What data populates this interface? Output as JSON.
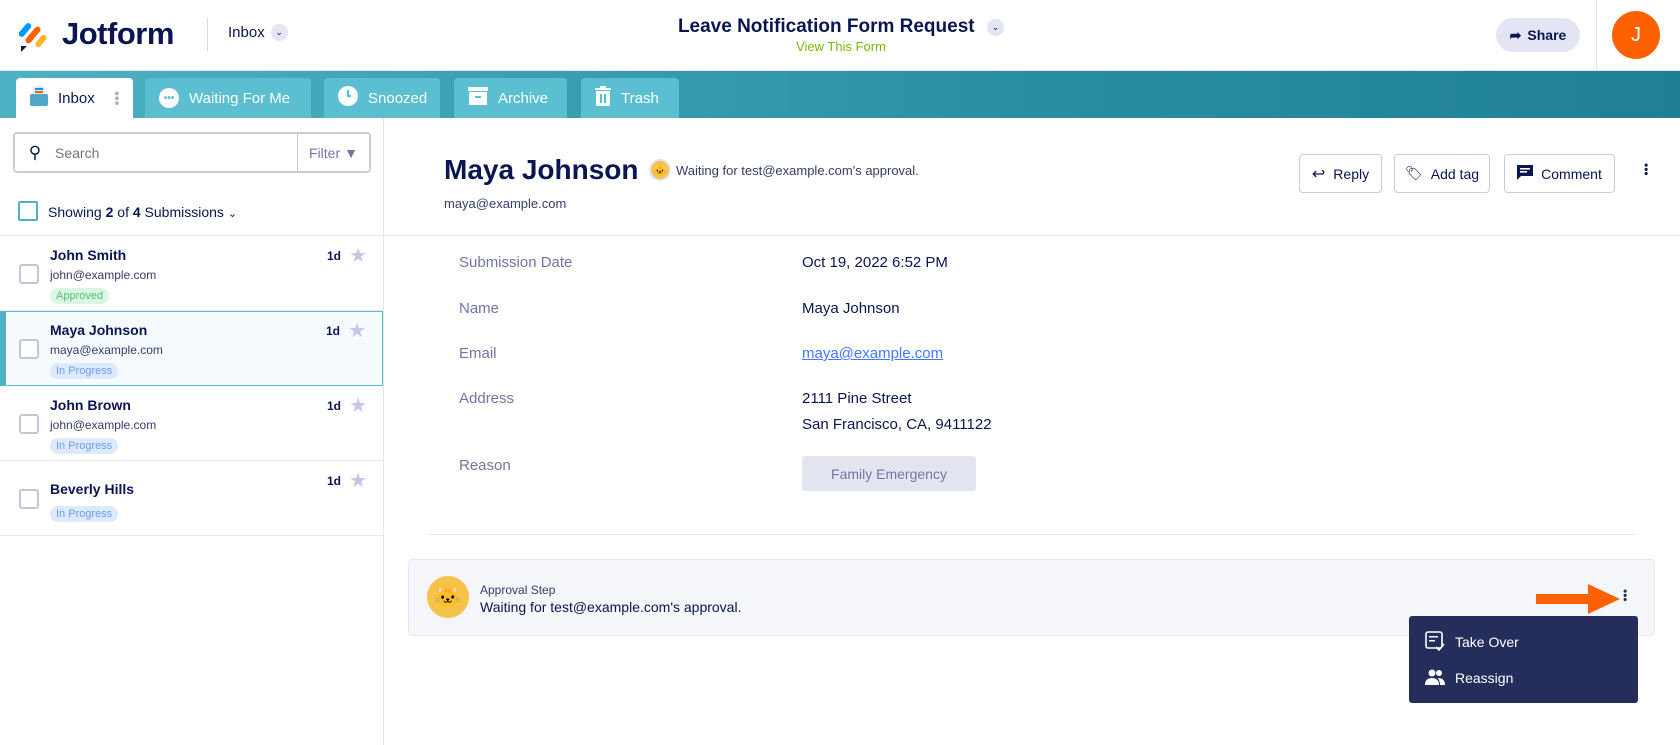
{
  "header": {
    "logo": "Jotform",
    "inbox_dropdown": "Inbox",
    "form_title": "Leave Notification Form Request",
    "view_form": "View This Form",
    "share": "Share",
    "avatar_initial": "J"
  },
  "tabs": [
    {
      "label": "Inbox",
      "icon": "inbox-icon"
    },
    {
      "label": "Waiting For Me",
      "icon": "more-circle-icon"
    },
    {
      "label": "Snoozed",
      "icon": "clock-icon"
    },
    {
      "label": "Archive",
      "icon": "archive-icon"
    },
    {
      "label": "Trash",
      "icon": "trash-icon"
    }
  ],
  "list": {
    "search_placeholder": "Search",
    "filter": "Filter",
    "showing_prefix": "Showing",
    "showing_count": "2",
    "showing_of": "of",
    "showing_total": "4",
    "showing_suffix": "Submissions",
    "items": [
      {
        "name": "John Smith",
        "email": "john@example.com",
        "status": "Approved",
        "age": "1d"
      },
      {
        "name": "Maya Johnson",
        "email": "maya@example.com",
        "status": "In Progress",
        "age": "1d"
      },
      {
        "name": "John Brown",
        "email": "john@example.com",
        "status": "In Progress",
        "age": "1d"
      },
      {
        "name": "Beverly Hills",
        "email": "",
        "status": "In Progress",
        "age": "1d"
      }
    ]
  },
  "detail": {
    "name": "Maya Johnson",
    "email": "maya@example.com",
    "status_text": "Waiting for test@example.com's approval.",
    "actions": {
      "reply": "Reply",
      "add_tag": "Add tag",
      "comment": "Comment"
    },
    "fields": [
      {
        "label": "Submission Date",
        "value": "Oct 19, 2022 6:52 PM"
      },
      {
        "label": "Name",
        "value": "Maya Johnson"
      },
      {
        "label": "Email",
        "value": "maya@example.com"
      },
      {
        "label": "Address",
        "value": "2111 Pine Street",
        "value2": "San Francisco, CA, 9411122"
      },
      {
        "label": "Reason",
        "value": "Family Emergency"
      }
    ]
  },
  "approval": {
    "title": "Approval Step",
    "text": "Waiting for test@example.com's approval."
  },
  "menu": {
    "items": [
      {
        "label": "Take Over",
        "icon": "take-over-icon"
      },
      {
        "label": "Reassign",
        "icon": "users-icon"
      }
    ]
  },
  "colors": {
    "accent": "#ff6100",
    "teal": "#4fb2c4",
    "navy": "#252d5b"
  }
}
